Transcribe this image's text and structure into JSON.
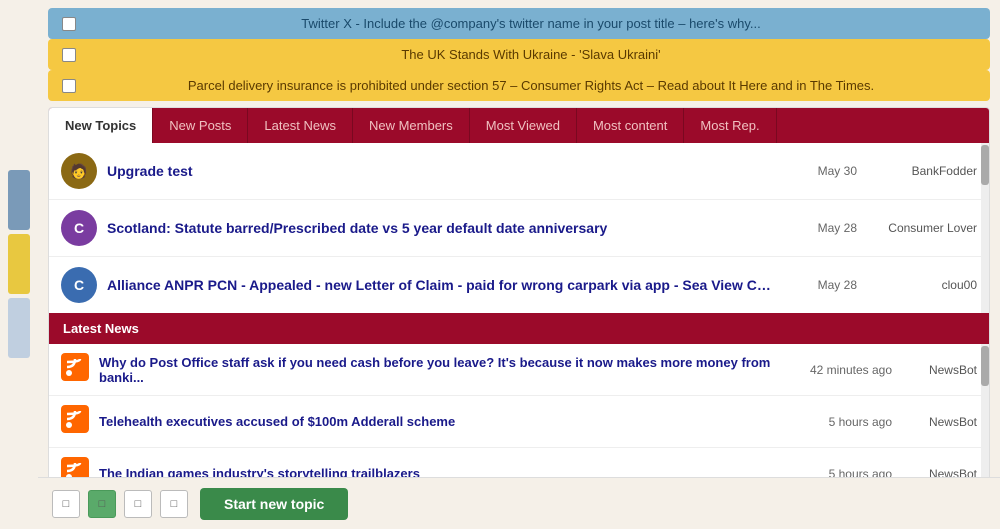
{
  "notices": [
    {
      "id": "twitter-notice",
      "type": "blue",
      "text": "Twitter X - Include the @company's twitter name in your post title – here's why..."
    },
    {
      "id": "ukraine-notice",
      "type": "yellow",
      "text": "The UK Stands With Ukraine - 'Slava Ukraini'"
    },
    {
      "id": "parcel-notice",
      "type": "yellow",
      "text": "Parcel delivery insurance is prohibited under section 57 – Consumer Rights Act – Read about It Here and in The Times."
    }
  ],
  "tabs": [
    {
      "id": "new-topics",
      "label": "New Topics",
      "active": true
    },
    {
      "id": "new-posts",
      "label": "New Posts",
      "active": false
    },
    {
      "id": "latest-news",
      "label": "Latest News",
      "active": false
    },
    {
      "id": "new-members",
      "label": "New Members",
      "active": false
    },
    {
      "id": "most-viewed",
      "label": "Most Viewed",
      "active": false
    },
    {
      "id": "most-content",
      "label": "Most content",
      "active": false
    },
    {
      "id": "most-rep",
      "label": "Most Rep.",
      "active": false
    }
  ],
  "topics": [
    {
      "id": "topic-1",
      "avatar_type": "brown",
      "avatar_label": "🧑",
      "title": "Upgrade test",
      "date": "May 30",
      "author": "BankFodder"
    },
    {
      "id": "topic-2",
      "avatar_type": "purple",
      "avatar_label": "C",
      "title": "Scotland: Statute barred/Prescribed date vs 5 year default date anniversary",
      "date": "May 28",
      "author": "Consumer Lover"
    },
    {
      "id": "topic-3",
      "avatar_type": "blue2",
      "avatar_label": "C",
      "title": "Alliance ANPR PCN - Appealed - new Letter of Claim - paid for wrong carpark via app - Sea View Car park, Polzeat",
      "date": "May 28",
      "author": "clou00"
    }
  ],
  "latest_news_header": "Latest News",
  "news_items": [
    {
      "id": "news-1",
      "title": "Why do Post Office staff ask if you need cash before you leave? It's because it now makes more money from banki...",
      "time": "42 minutes ago",
      "author": "NewsBot"
    },
    {
      "id": "news-2",
      "title": "Telehealth executives accused of $100m Adderall scheme",
      "time": "5 hours ago",
      "author": "NewsBot"
    },
    {
      "id": "news-3",
      "title": "The Indian games industry's storytelling trailblazers",
      "time": "5 hours ago",
      "author": "NewsBot"
    }
  ],
  "bottom_bar": {
    "start_topic_label": "Start new topic",
    "icons": [
      "□",
      "□",
      "□"
    ]
  }
}
